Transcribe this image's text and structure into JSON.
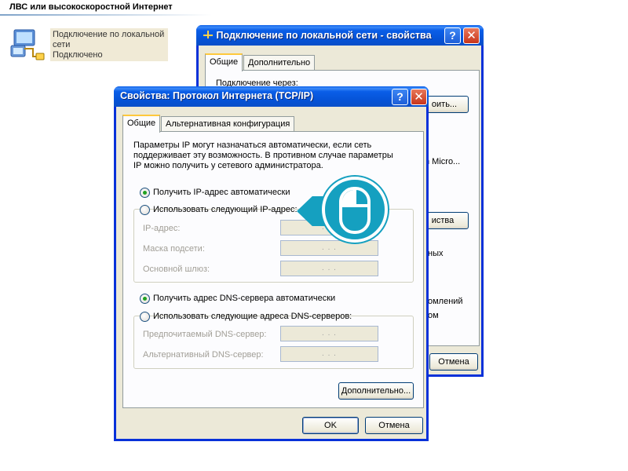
{
  "section_header": "ЛВС или высокоскоростной Интернет",
  "connection": {
    "name": "Подключение по локальной сети",
    "status": "Подключено"
  },
  "back_window": {
    "title": "Подключение по локальной сети - свойства",
    "tabs": [
      "Общие",
      "Дополнительно"
    ],
    "connect_via_label": "Подключение через:",
    "configure_button_partial": "оить...",
    "adapter_partial": "n Micro...",
    "properties_button_partial": "иства",
    "desc_partial_1": "ных",
    "desc_partial_2": "омлений",
    "desc_partial_3": "ом",
    "cancel_button": "Отмена"
  },
  "front_window": {
    "title": "Свойства: Протокол Интернета (TCP/IP)",
    "tabs": [
      "Общие",
      "Альтернативная конфигурация"
    ],
    "description": [
      "Параметры IP могут назначаться автоматически, если сеть",
      "поддерживает эту возможность. В противном случае параметры",
      "IP можно получить у сетевого администратора."
    ],
    "ip_auto_label": "Получить IP-адрес автоматически",
    "ip_manual_label": "Использовать следующий IP-адрес:",
    "ip_fields": [
      {
        "label": "IP-адрес:",
        "value": ". . ."
      },
      {
        "label": "Маска подсети:",
        "value": ". . ."
      },
      {
        "label": "Основной шлюз:",
        "value": ". . ."
      }
    ],
    "dns_auto_label": "Получить адрес DNS-сервера автоматически",
    "dns_manual_label": "Использовать следующие адреса DNS-серверов:",
    "dns_fields": [
      {
        "label": "Предпочитаемый DNS-сервер:",
        "value": ". . ."
      },
      {
        "label": "Альтернативный DNS-сервер:",
        "value": ". . ."
      }
    ],
    "advanced_button": "Дополнительно...",
    "ok_button": "OK",
    "cancel_button": "Отмена",
    "selected": {
      "ip": "auto",
      "dns": "auto"
    }
  },
  "help_glyph": "?",
  "close_glyph": "✕",
  "colors": {
    "titlebar": "#0a5ee8",
    "callout": "#15a0c0",
    "radio_selected": "#21a121"
  },
  "icons": [
    "network-connection-icon",
    "help-icon",
    "close-icon",
    "mouse-icon",
    "network-title-icon"
  ]
}
